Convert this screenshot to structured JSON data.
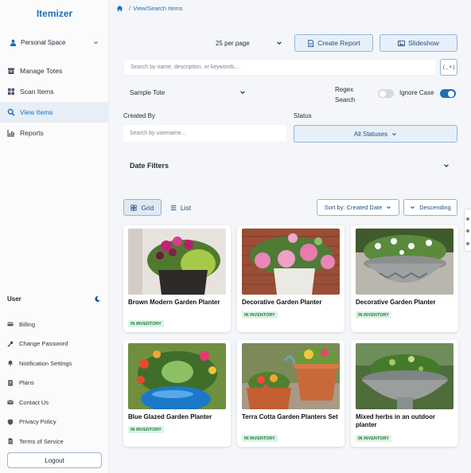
{
  "app": {
    "name": "Itemizer"
  },
  "sidebar": {
    "space_label": "Personal Space",
    "nav": [
      {
        "label": "Manage Totes",
        "icon": "totes-icon"
      },
      {
        "label": "Scan Items",
        "icon": "scan-icon"
      },
      {
        "label": "View Items",
        "icon": "search-icon",
        "active": true
      },
      {
        "label": "Reports",
        "icon": "reports-icon"
      }
    ],
    "user_heading": "User",
    "account": [
      {
        "label": "Billing",
        "icon": "billing-icon"
      },
      {
        "label": "Change Password",
        "icon": "key-icon"
      },
      {
        "label": "Notification Settings",
        "icon": "bell-icon"
      },
      {
        "label": "Plans",
        "icon": "plans-icon"
      },
      {
        "label": "Contact Us",
        "icon": "mail-icon"
      },
      {
        "label": "Privacy Policy",
        "icon": "shield-icon"
      },
      {
        "label": "Terms of Service",
        "icon": "document-icon"
      }
    ],
    "logout_label": "Logout"
  },
  "breadcrumb": {
    "current": "View/Search Items"
  },
  "toolbar": {
    "per_page": "25 per page",
    "create_report": "Create Report",
    "slideshow": "Slideshow"
  },
  "search": {
    "placeholder": "Search by name, description, or keywords...",
    "regex_button": "(.*)"
  },
  "filters": {
    "tote_value": "Sample Tote",
    "regex_label": "Regex Search",
    "regex_on": false,
    "ignore_case_label": "Ignore Case",
    "ignore_case_on": true,
    "created_by_label": "Created By",
    "created_by_placeholder": "Search by username...",
    "status_label": "Status",
    "status_value": "All Statuses",
    "date_filters_label": "Date Filters"
  },
  "view": {
    "grid_label": "Grid",
    "list_label": "List",
    "sort_label": "Sort by: Created Date",
    "order_label": "Descending"
  },
  "items": [
    {
      "title": "Brown Modern Garden Planter",
      "status": "IN INVENTORY"
    },
    {
      "title": "Decorative Garden Planter",
      "status": "IN INVENTORY"
    },
    {
      "title": "Decorative Garden Planter",
      "status": "IN INVENTORY"
    },
    {
      "title": "Blue Glazed Garden Planter",
      "status": "IN INVENTORY"
    },
    {
      "title": "Terra Cotta Garden Planters Set",
      "status": "IN INVENTORY"
    },
    {
      "title": "Mixed herbs in an outdoor planter",
      "status": "IN INVENTORY"
    }
  ],
  "colors": {
    "accent": "#1d6fb8",
    "badge_bg": "#dff3e5",
    "badge_text": "#1e7e3e",
    "page_bg": "#f4f6f9"
  }
}
